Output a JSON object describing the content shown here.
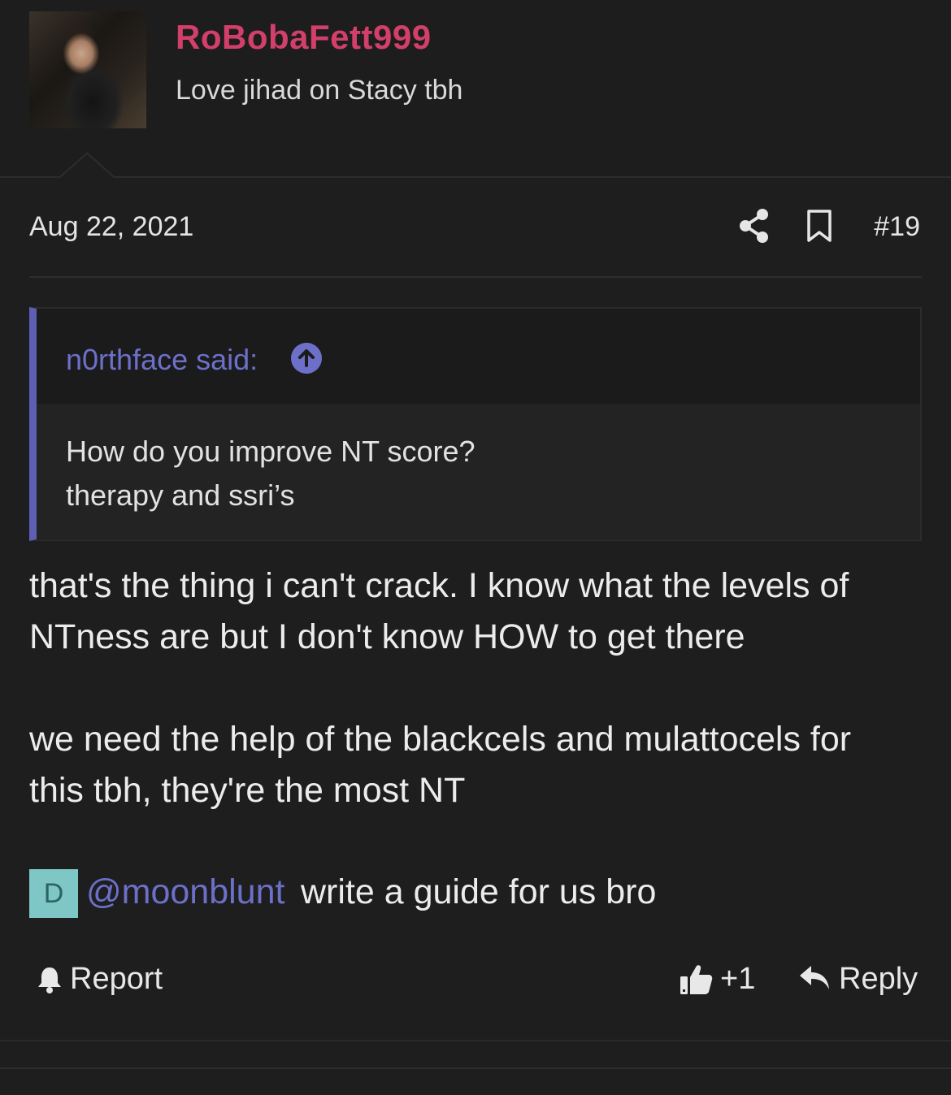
{
  "author": {
    "username": "RoBobaFett999",
    "title": "Love jihad on Stacy tbh"
  },
  "post": {
    "date": "Aug 22, 2021",
    "number": "#19"
  },
  "quote": {
    "author": "n0rthface said:",
    "lines": [
      "How do you improve NT score?",
      "therapy and ssri’s"
    ]
  },
  "message": {
    "lines": [
      "that's the thing i can't crack. I know what the levels of",
      "NTness are but I don't know HOW to get there",
      "we need the help of the blackcels and mulattocels for",
      "this tbh, they're the most NT"
    ],
    "mention_avatar_letter": "D",
    "mention": "@moonblunt",
    "mention_rest": "write a guide for us bro"
  },
  "actions": {
    "report": "Report",
    "like": "+1",
    "reply": "Reply"
  },
  "colors": {
    "username": "#d23f6a",
    "link": "#6c70c8",
    "quote_bar": "#5d5fb4",
    "background": "#1e1e1f",
    "mention_avatar_bg": "#7fc7c7"
  }
}
